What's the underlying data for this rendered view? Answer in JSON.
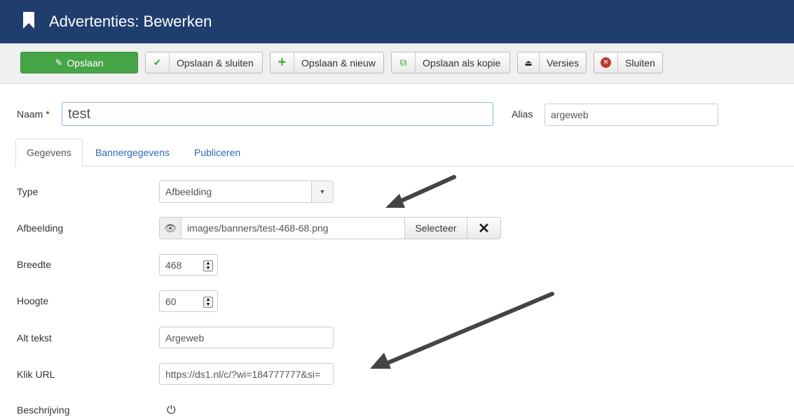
{
  "header": {
    "title": "Advertenties: Bewerken",
    "icon": "bookmark-icon"
  },
  "toolbar": {
    "save": "Opslaan",
    "save_close": "Opslaan & sluiten",
    "save_new": "Opslaan & nieuw",
    "save_copy": "Opslaan als kopie",
    "versions": "Versies",
    "close": "Sluiten"
  },
  "form": {
    "name_label": "Naam *",
    "name_value": "test",
    "alias_label": "Alias",
    "alias_value": "argeweb",
    "tabs": [
      "Gegevens",
      "Bannergegevens",
      "Publiceren"
    ],
    "type_label": "Type",
    "type_value": "Afbeelding",
    "image_label": "Afbeelding",
    "image_value": "images/banners/test-468-68.png",
    "select_label": "Selecteer",
    "width_label": "Breedte",
    "width_value": "468",
    "height_label": "Hoogte",
    "height_value": "60",
    "alt_label": "Alt tekst",
    "alt_value": "Argeweb",
    "url_label": "Klik URL",
    "url_value": "https://ds1.nl/c/?wi=184777777&si=",
    "desc_label": "Beschrijving"
  },
  "colors": {
    "header_bg": "#1f3e6e",
    "save_green": "#46a546",
    "link_blue": "#2a69b8"
  }
}
